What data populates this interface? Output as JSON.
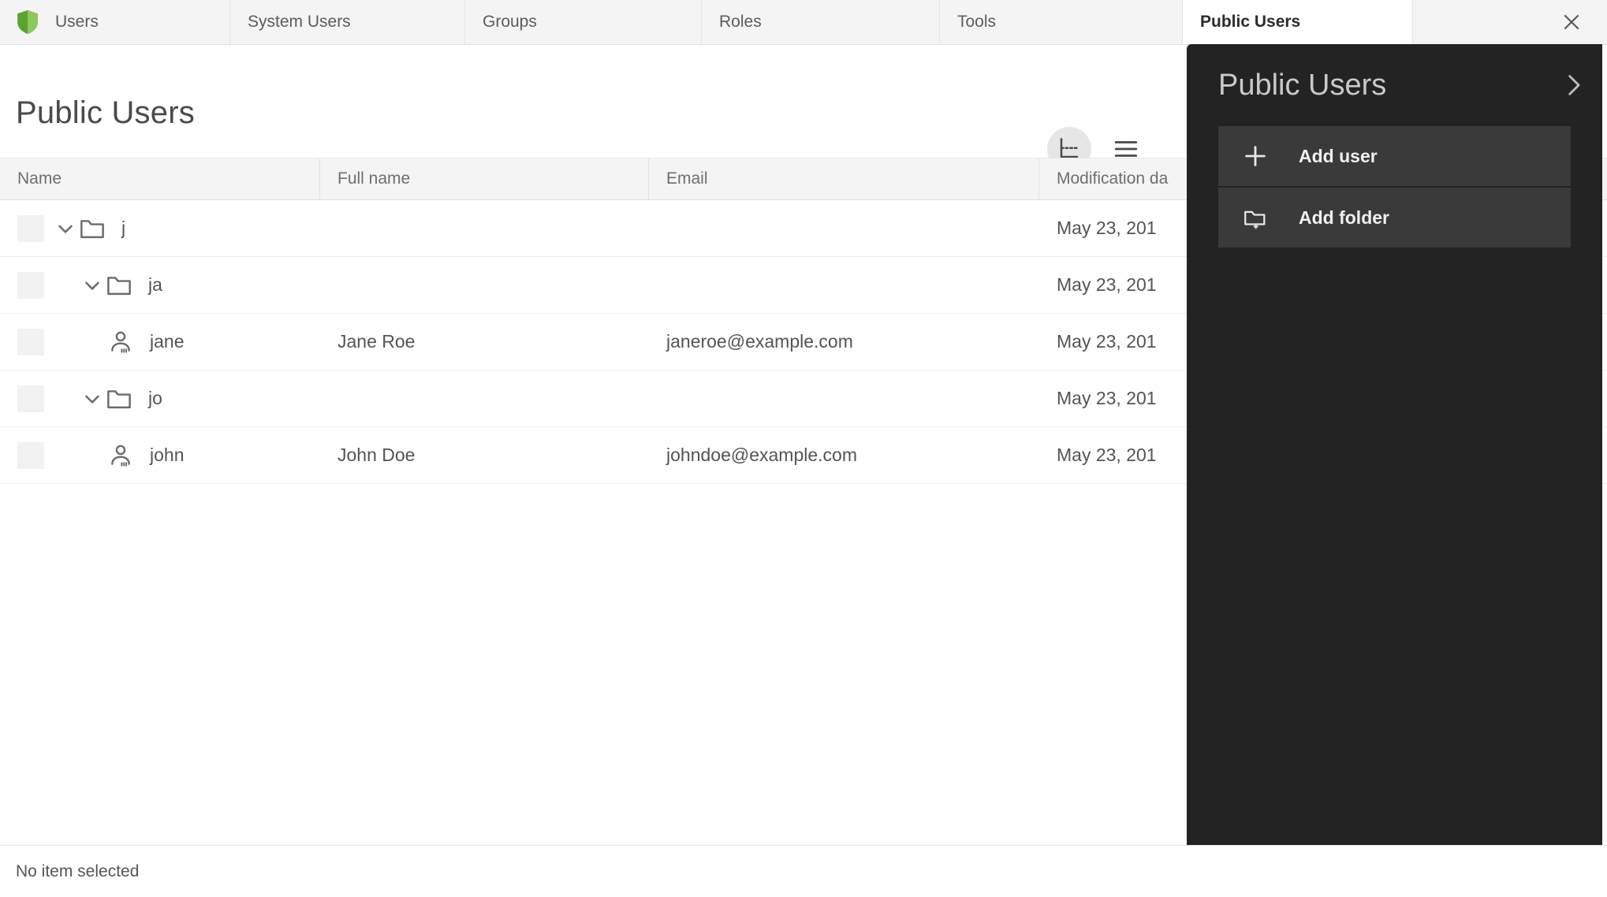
{
  "tabs": {
    "items": [
      {
        "label": "Users",
        "icon": "shield-icon",
        "active": false
      },
      {
        "label": "System Users",
        "icon": "",
        "active": false
      },
      {
        "label": "Groups",
        "icon": "",
        "active": false
      },
      {
        "label": "Roles",
        "icon": "",
        "active": false
      },
      {
        "label": "Tools",
        "icon": "",
        "active": false
      },
      {
        "label": "Public Users",
        "icon": "",
        "active": true
      }
    ],
    "close_icon": "close-icon"
  },
  "header": {
    "title": "Public Users",
    "tree_view_icon": "tree-view-icon",
    "menu_icon": "hamburger-menu-icon"
  },
  "table": {
    "columns": [
      "Name",
      "Full name",
      "Email",
      "Modification da"
    ],
    "rows": [
      {
        "type": "folder",
        "depth": 0,
        "name": "j",
        "full_name": "",
        "email": "",
        "modified": "May 23, 201"
      },
      {
        "type": "folder",
        "depth": 1,
        "name": "ja",
        "full_name": "",
        "email": "",
        "modified": "May 23, 201"
      },
      {
        "type": "user",
        "depth": 2,
        "name": "jane",
        "full_name": "Jane Roe",
        "email": "janeroe@example.com",
        "modified": "May 23, 201"
      },
      {
        "type": "folder",
        "depth": 1,
        "name": "jo",
        "full_name": "",
        "email": "",
        "modified": "May 23, 201"
      },
      {
        "type": "user",
        "depth": 2,
        "name": "john",
        "full_name": "John Doe",
        "email": "johndoe@example.com",
        "modified": "May 23, 201"
      }
    ]
  },
  "footer": {
    "status": "No item selected"
  },
  "panel": {
    "title": "Public Users",
    "expand_icon": "chevron-right-icon",
    "actions": [
      {
        "label": "Add user",
        "icon": "plus-icon"
      },
      {
        "label": "Add folder",
        "icon": "add-folder-icon"
      }
    ]
  },
  "colors": {
    "brand_green": "#6cb33f",
    "panel_bg": "#232323",
    "panel_action_bg": "#3a3a3a",
    "tab_bar_bg": "#f4f4f4"
  }
}
